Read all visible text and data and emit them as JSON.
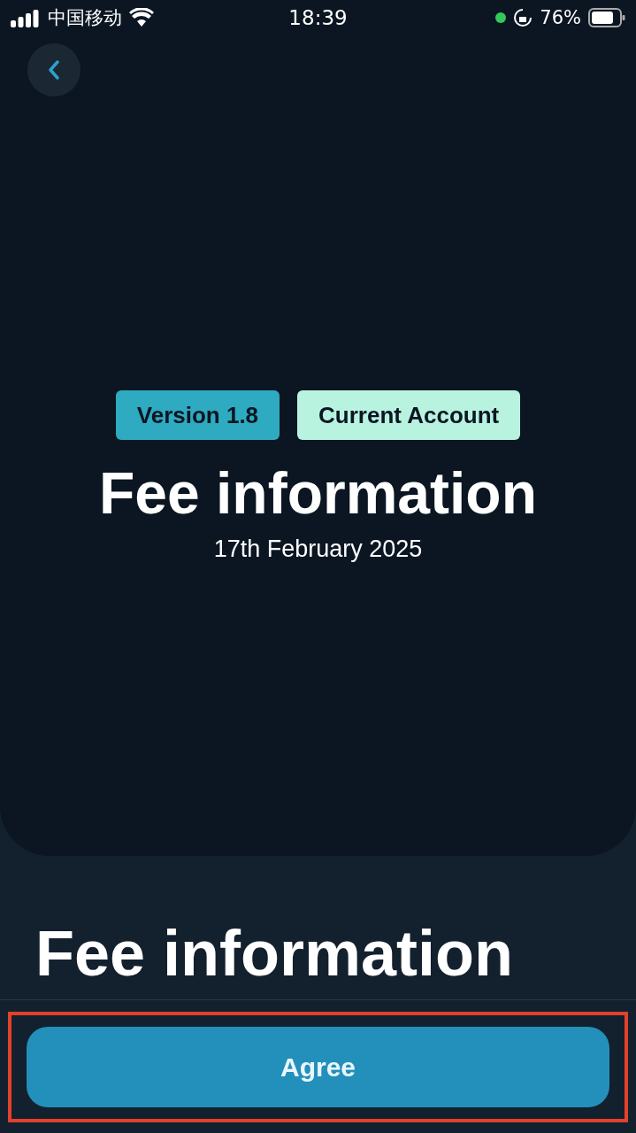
{
  "status_bar": {
    "carrier": "中国移动",
    "time": "18:39",
    "battery_text": "76%"
  },
  "hero": {
    "tags": [
      {
        "label": "Version 1.8",
        "color": "#2eaac1"
      },
      {
        "label": "Current Account",
        "color": "#b8f3e0"
      }
    ],
    "title": "Fee information",
    "date": "17th February 2025"
  },
  "section_title": "Fee information",
  "agree_button": {
    "label": "Agree",
    "highlighted": true
  }
}
